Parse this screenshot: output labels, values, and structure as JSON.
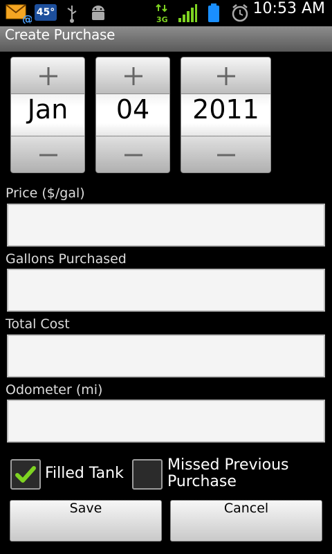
{
  "status_bar": {
    "temperature": "45°",
    "network": "3G",
    "time": "10:53 AM",
    "icons": [
      "email-notification-icon",
      "usb-icon",
      "android-debug-icon",
      "network-3g-icon",
      "signal-icon",
      "battery-icon",
      "alarm-icon"
    ]
  },
  "title_bar": {
    "title": "Create Purchase"
  },
  "date_picker": {
    "month": "Jan",
    "day": "04",
    "year": "2011"
  },
  "fields": {
    "price": {
      "label": "Price ($/gal)",
      "value": ""
    },
    "gallons": {
      "label": "Gallons Purchased",
      "value": ""
    },
    "total": {
      "label": "Total Cost",
      "value": ""
    },
    "odometer": {
      "label": "Odometer (mi)",
      "value": ""
    }
  },
  "checkboxes": {
    "filled_tank": {
      "label": "Filled Tank",
      "checked": true
    },
    "missed_previous": {
      "label_line1": "Missed Previous",
      "label_line2": "Purchase",
      "checked": false
    }
  },
  "buttons": {
    "save": "Save",
    "cancel": "Cancel"
  },
  "colors": {
    "check_accent": "#7ed321",
    "temp_badge": "#1d4f9c",
    "battery": "#1a8fff",
    "network": "#7ed321"
  }
}
